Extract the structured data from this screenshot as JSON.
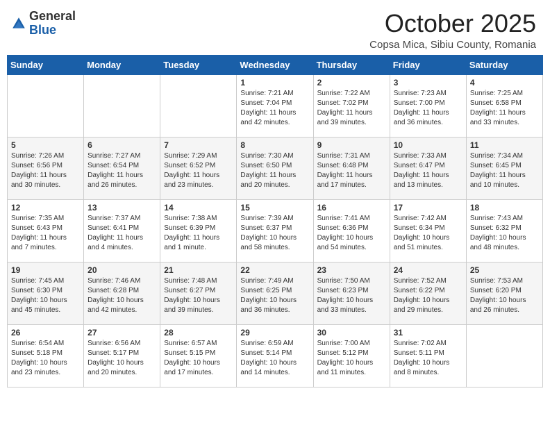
{
  "header": {
    "logo_general": "General",
    "logo_blue": "Blue",
    "month": "October 2025",
    "location": "Copsa Mica, Sibiu County, Romania"
  },
  "days_of_week": [
    "Sunday",
    "Monday",
    "Tuesday",
    "Wednesday",
    "Thursday",
    "Friday",
    "Saturday"
  ],
  "weeks": [
    [
      {
        "day": "",
        "detail": ""
      },
      {
        "day": "",
        "detail": ""
      },
      {
        "day": "",
        "detail": ""
      },
      {
        "day": "1",
        "detail": "Sunrise: 7:21 AM\nSunset: 7:04 PM\nDaylight: 11 hours\nand 42 minutes."
      },
      {
        "day": "2",
        "detail": "Sunrise: 7:22 AM\nSunset: 7:02 PM\nDaylight: 11 hours\nand 39 minutes."
      },
      {
        "day": "3",
        "detail": "Sunrise: 7:23 AM\nSunset: 7:00 PM\nDaylight: 11 hours\nand 36 minutes."
      },
      {
        "day": "4",
        "detail": "Sunrise: 7:25 AM\nSunset: 6:58 PM\nDaylight: 11 hours\nand 33 minutes."
      }
    ],
    [
      {
        "day": "5",
        "detail": "Sunrise: 7:26 AM\nSunset: 6:56 PM\nDaylight: 11 hours\nand 30 minutes."
      },
      {
        "day": "6",
        "detail": "Sunrise: 7:27 AM\nSunset: 6:54 PM\nDaylight: 11 hours\nand 26 minutes."
      },
      {
        "day": "7",
        "detail": "Sunrise: 7:29 AM\nSunset: 6:52 PM\nDaylight: 11 hours\nand 23 minutes."
      },
      {
        "day": "8",
        "detail": "Sunrise: 7:30 AM\nSunset: 6:50 PM\nDaylight: 11 hours\nand 20 minutes."
      },
      {
        "day": "9",
        "detail": "Sunrise: 7:31 AM\nSunset: 6:48 PM\nDaylight: 11 hours\nand 17 minutes."
      },
      {
        "day": "10",
        "detail": "Sunrise: 7:33 AM\nSunset: 6:47 PM\nDaylight: 11 hours\nand 13 minutes."
      },
      {
        "day": "11",
        "detail": "Sunrise: 7:34 AM\nSunset: 6:45 PM\nDaylight: 11 hours\nand 10 minutes."
      }
    ],
    [
      {
        "day": "12",
        "detail": "Sunrise: 7:35 AM\nSunset: 6:43 PM\nDaylight: 11 hours\nand 7 minutes."
      },
      {
        "day": "13",
        "detail": "Sunrise: 7:37 AM\nSunset: 6:41 PM\nDaylight: 11 hours\nand 4 minutes."
      },
      {
        "day": "14",
        "detail": "Sunrise: 7:38 AM\nSunset: 6:39 PM\nDaylight: 11 hours\nand 1 minute."
      },
      {
        "day": "15",
        "detail": "Sunrise: 7:39 AM\nSunset: 6:37 PM\nDaylight: 10 hours\nand 58 minutes."
      },
      {
        "day": "16",
        "detail": "Sunrise: 7:41 AM\nSunset: 6:36 PM\nDaylight: 10 hours\nand 54 minutes."
      },
      {
        "day": "17",
        "detail": "Sunrise: 7:42 AM\nSunset: 6:34 PM\nDaylight: 10 hours\nand 51 minutes."
      },
      {
        "day": "18",
        "detail": "Sunrise: 7:43 AM\nSunset: 6:32 PM\nDaylight: 10 hours\nand 48 minutes."
      }
    ],
    [
      {
        "day": "19",
        "detail": "Sunrise: 7:45 AM\nSunset: 6:30 PM\nDaylight: 10 hours\nand 45 minutes."
      },
      {
        "day": "20",
        "detail": "Sunrise: 7:46 AM\nSunset: 6:28 PM\nDaylight: 10 hours\nand 42 minutes."
      },
      {
        "day": "21",
        "detail": "Sunrise: 7:48 AM\nSunset: 6:27 PM\nDaylight: 10 hours\nand 39 minutes."
      },
      {
        "day": "22",
        "detail": "Sunrise: 7:49 AM\nSunset: 6:25 PM\nDaylight: 10 hours\nand 36 minutes."
      },
      {
        "day": "23",
        "detail": "Sunrise: 7:50 AM\nSunset: 6:23 PM\nDaylight: 10 hours\nand 33 minutes."
      },
      {
        "day": "24",
        "detail": "Sunrise: 7:52 AM\nSunset: 6:22 PM\nDaylight: 10 hours\nand 29 minutes."
      },
      {
        "day": "25",
        "detail": "Sunrise: 7:53 AM\nSunset: 6:20 PM\nDaylight: 10 hours\nand 26 minutes."
      }
    ],
    [
      {
        "day": "26",
        "detail": "Sunrise: 6:54 AM\nSunset: 5:18 PM\nDaylight: 10 hours\nand 23 minutes."
      },
      {
        "day": "27",
        "detail": "Sunrise: 6:56 AM\nSunset: 5:17 PM\nDaylight: 10 hours\nand 20 minutes."
      },
      {
        "day": "28",
        "detail": "Sunrise: 6:57 AM\nSunset: 5:15 PM\nDaylight: 10 hours\nand 17 minutes."
      },
      {
        "day": "29",
        "detail": "Sunrise: 6:59 AM\nSunset: 5:14 PM\nDaylight: 10 hours\nand 14 minutes."
      },
      {
        "day": "30",
        "detail": "Sunrise: 7:00 AM\nSunset: 5:12 PM\nDaylight: 10 hours\nand 11 minutes."
      },
      {
        "day": "31",
        "detail": "Sunrise: 7:02 AM\nSunset: 5:11 PM\nDaylight: 10 hours\nand 8 minutes."
      },
      {
        "day": "",
        "detail": ""
      }
    ]
  ]
}
